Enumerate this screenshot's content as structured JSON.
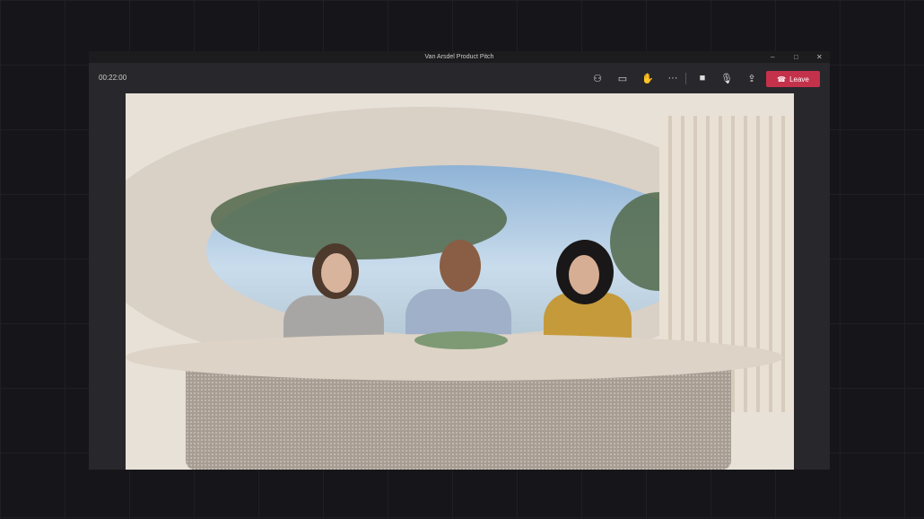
{
  "window": {
    "title": "Van Arsdel Product Pitch",
    "controls": [
      "minimize",
      "maximize",
      "close"
    ]
  },
  "toolbar": {
    "timer": "00:22:00",
    "buttons": [
      "people-icon",
      "chat-icon",
      "raise-hand-icon",
      "more-icon",
      "camera-icon",
      "mic-icon",
      "share-icon"
    ],
    "leave_label": "Leave",
    "leave_color": "#c4314b"
  },
  "stage": {
    "participants": 3
  }
}
